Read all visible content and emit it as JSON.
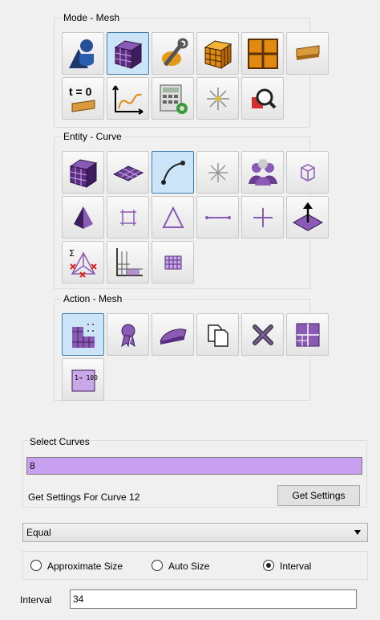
{
  "mode_group": {
    "title": "Mode - Mesh",
    "buttons": [
      {
        "icon": "geometry-icon",
        "active": false
      },
      {
        "icon": "mesh-cube-icon",
        "active": true
      },
      {
        "icon": "tools-icon",
        "active": false
      },
      {
        "icon": "gold-cube-icon",
        "active": false
      },
      {
        "icon": "grid-icon",
        "active": false
      },
      {
        "icon": "surface-strip-icon",
        "active": false
      },
      {
        "icon": "time-zero-icon",
        "label": "t = 0",
        "active": false
      },
      {
        "icon": "plot-icon",
        "active": false
      },
      {
        "icon": "calculator-icon",
        "active": false
      },
      {
        "icon": "node-star-icon",
        "active": false
      },
      {
        "icon": "search-magnify-icon",
        "active": false
      }
    ]
  },
  "entity_group": {
    "title": "Entity - Curve",
    "buttons": [
      {
        "icon": "volume-mesh-icon",
        "active": false
      },
      {
        "icon": "surface-mesh-icon",
        "active": false
      },
      {
        "icon": "curve-icon",
        "active": true
      },
      {
        "icon": "vertex-star-icon",
        "active": false
      },
      {
        "icon": "groups-icon",
        "active": false
      },
      {
        "icon": "volume-wire-icon",
        "active": false
      },
      {
        "icon": "pyramid-icon",
        "active": false
      },
      {
        "icon": "quad-icon",
        "active": false
      },
      {
        "icon": "triangle-icon",
        "active": false
      },
      {
        "icon": "edge-icon",
        "active": false
      },
      {
        "icon": "node-cross-icon",
        "active": false
      },
      {
        "icon": "normal-plane-icon",
        "active": false
      },
      {
        "icon": "sigma-network-icon",
        "label": "Σ",
        "active": false
      },
      {
        "icon": "block-grid-icon",
        "active": false
      },
      {
        "icon": "table-grid-icon",
        "active": false
      }
    ]
  },
  "action_group": {
    "title": "Action - Mesh",
    "buttons": [
      {
        "icon": "mesh-action-icon",
        "active": true
      },
      {
        "icon": "ribbon-icon",
        "active": false
      },
      {
        "icon": "iron-smooth-icon",
        "active": false
      },
      {
        "icon": "copy-icon",
        "active": false
      },
      {
        "icon": "delete-x-icon",
        "active": false
      },
      {
        "icon": "refine-icon",
        "active": false
      },
      {
        "icon": "renumber-icon",
        "label": "1→ 100",
        "active": false
      }
    ]
  },
  "select": {
    "title": "Select Curves",
    "value": "8",
    "settings_text": "Get Settings For Curve 12",
    "get_settings_label": "Get Settings"
  },
  "scheme": {
    "value": "Equal"
  },
  "sizing": {
    "options": [
      {
        "label": "Approximate Size",
        "checked": false
      },
      {
        "label": "Auto Size",
        "checked": false
      },
      {
        "label": "Interval",
        "checked": true
      }
    ]
  },
  "interval": {
    "label": "Interval",
    "value": "34"
  },
  "colors": {
    "accent_purple": "#c8a0f0",
    "active_blue": "#cce4f7",
    "mesh_purple": "#5a2d82"
  }
}
